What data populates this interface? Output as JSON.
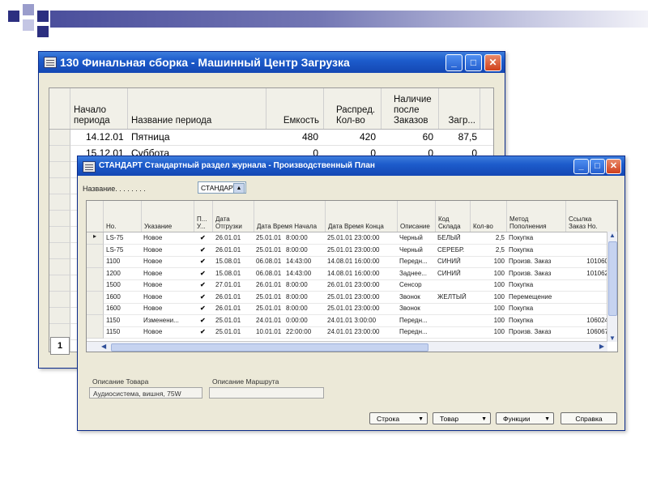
{
  "window1": {
    "title": "130 Финальная сборка - Машинный Центр Загрузка",
    "columns": [
      "Начало периода",
      "Название периода",
      "Емкость",
      "Распред. Кол-во",
      "Наличие после Заказов",
      "Загр..."
    ],
    "rows": [
      [
        "14.12.01",
        "Пятница",
        "480",
        "420",
        "60",
        "87,5"
      ],
      [
        "15.12.01",
        "Суббота",
        "0",
        "0",
        "0",
        "0"
      ]
    ],
    "page_button": "1"
  },
  "window2": {
    "title": "СТАНДАРТ Стандартный раздел журнала - Производственный План",
    "name_label": "Название. . . . . . . .",
    "name_value": "СТАНДАРТ",
    "columns": [
      "Но.",
      "Указание",
      "П... У...",
      "Дата Отгрузки",
      "Дата Время Начала",
      "Дата Время Конца",
      "Описание",
      "Код Склада",
      "Кол-во",
      "Метод Пополнения",
      "Ссылка Заказ Но."
    ],
    "rows": [
      [
        "LS-75",
        "Новое",
        "✔",
        "26.01.01",
        "25.01.01",
        "8:00:00",
        "25.01.01 23:00:00",
        "Черный",
        "БЕЛЫЙ",
        "2,5",
        "Покупка",
        ""
      ],
      [
        "LS-75",
        "Новое",
        "✔",
        "26.01.01",
        "25.01.01",
        "8:00:00",
        "25.01.01 23:00:00",
        "Черный",
        "СЕРЕБР.",
        "2,5",
        "Покупка",
        ""
      ],
      [
        "1100",
        "Новое",
        "✔",
        "15.08.01",
        "06.08.01",
        "14:43:00",
        "14.08.01 16:00:00",
        "Передн...",
        "СИНИЙ",
        "100",
        "Произв. Заказ",
        "101060"
      ],
      [
        "1200",
        "Новое",
        "✔",
        "15.08.01",
        "06.08.01",
        "14:43:00",
        "14.08.01 16:00:00",
        "Заднее...",
        "СИНИЙ",
        "100",
        "Произв. Заказ",
        "101062"
      ],
      [
        "1500",
        "Новое",
        "✔",
        "27.01.01",
        "26.01.01",
        "8:00:00",
        "26.01.01 23:00:00",
        "Сенсор",
        "",
        "100",
        "Покупка",
        ""
      ],
      [
        "1600",
        "Новое",
        "✔",
        "26.01.01",
        "25.01.01",
        "8:00:00",
        "25.01.01 23:00:00",
        "Звонок",
        "ЖЕЛТЫЙ",
        "100",
        "Перемещение",
        ""
      ],
      [
        "1600",
        "Новое",
        "✔",
        "26.01.01",
        "25.01.01",
        "8:00:00",
        "25.01.01 23:00:00",
        "Звонок",
        "",
        "100",
        "Покупка",
        ""
      ],
      [
        "1150",
        "Изменени...",
        "✔",
        "25.01.01",
        "24.01.01",
        "0:00:00",
        "24.01.01 3:00:00",
        "Передн...",
        "",
        "100",
        "Покупка",
        "106024"
      ],
      [
        "1150",
        "Новое",
        "✔",
        "25.01.01",
        "10.01.01",
        "22:00:00",
        "24.01.01 23:00:00",
        "Передн...",
        "",
        "100",
        "Произв. Заказ",
        "106067"
      ]
    ],
    "item_description_label": "Описание Товара",
    "item_description_value": "Аудиосистема, вишня, 75W",
    "route_description_label": "Описание Маршрута",
    "route_description_value": "",
    "buttons": {
      "line": "Строка",
      "item": "Товар",
      "functions": "Функции",
      "help": "Справка"
    }
  },
  "colors": {
    "titlebar": "#1d5ccc",
    "deco_bar": "#4b4f9c",
    "close_button": "#d0401c"
  }
}
